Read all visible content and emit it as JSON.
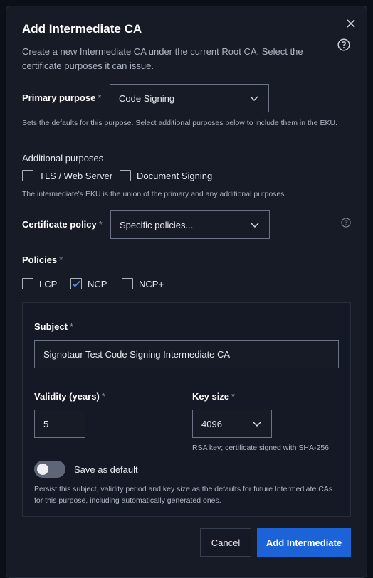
{
  "dialog": {
    "title": "Add Intermediate CA",
    "description": "Create a new Intermediate CA under the current Root CA. Select the certificate purposes it can issue.",
    "close_icon": "close-icon",
    "help_icon": "help-circle-icon"
  },
  "primary_purpose": {
    "label": "Primary purpose",
    "required": "*",
    "value": "Code Signing",
    "hint": "Sets the defaults for this purpose. Select additional purposes below to include them in the EKU."
  },
  "additional_purposes": {
    "label": "Additional purposes",
    "options": [
      {
        "label": "TLS / Web Server",
        "checked": false
      },
      {
        "label": "Document Signing",
        "checked": false
      }
    ],
    "hint": "The intermediate's EKU is the union of the primary and any additional purposes."
  },
  "certificate_policy": {
    "label": "Certificate policy",
    "required": "*",
    "value": "Specific policies..."
  },
  "policies": {
    "label": "Policies",
    "required": "*",
    "options": [
      {
        "label": "LCP",
        "checked": false
      },
      {
        "label": "NCP",
        "checked": true
      },
      {
        "label": "NCP+",
        "checked": false
      }
    ]
  },
  "subject": {
    "label": "Subject",
    "required": "*",
    "value": "Signotaur Test Code Signing Intermediate CA"
  },
  "validity": {
    "label": "Validity (years)",
    "required": "*",
    "value": "5"
  },
  "key_size": {
    "label": "Key size",
    "required": "*",
    "value": "4096",
    "hint": "RSA key; certificate signed with SHA-256."
  },
  "save_default": {
    "label": "Save as default",
    "enabled": false,
    "hint": "Persist this subject, validity period and key size as the defaults for future Intermediate CAs for this purpose, including automatically generated ones."
  },
  "actions": {
    "cancel": "Cancel",
    "submit": "Add Intermediate"
  },
  "colors": {
    "primary_button": "#1b63d6",
    "checkbox_border": "#aab2c0",
    "background": "#161b26"
  }
}
